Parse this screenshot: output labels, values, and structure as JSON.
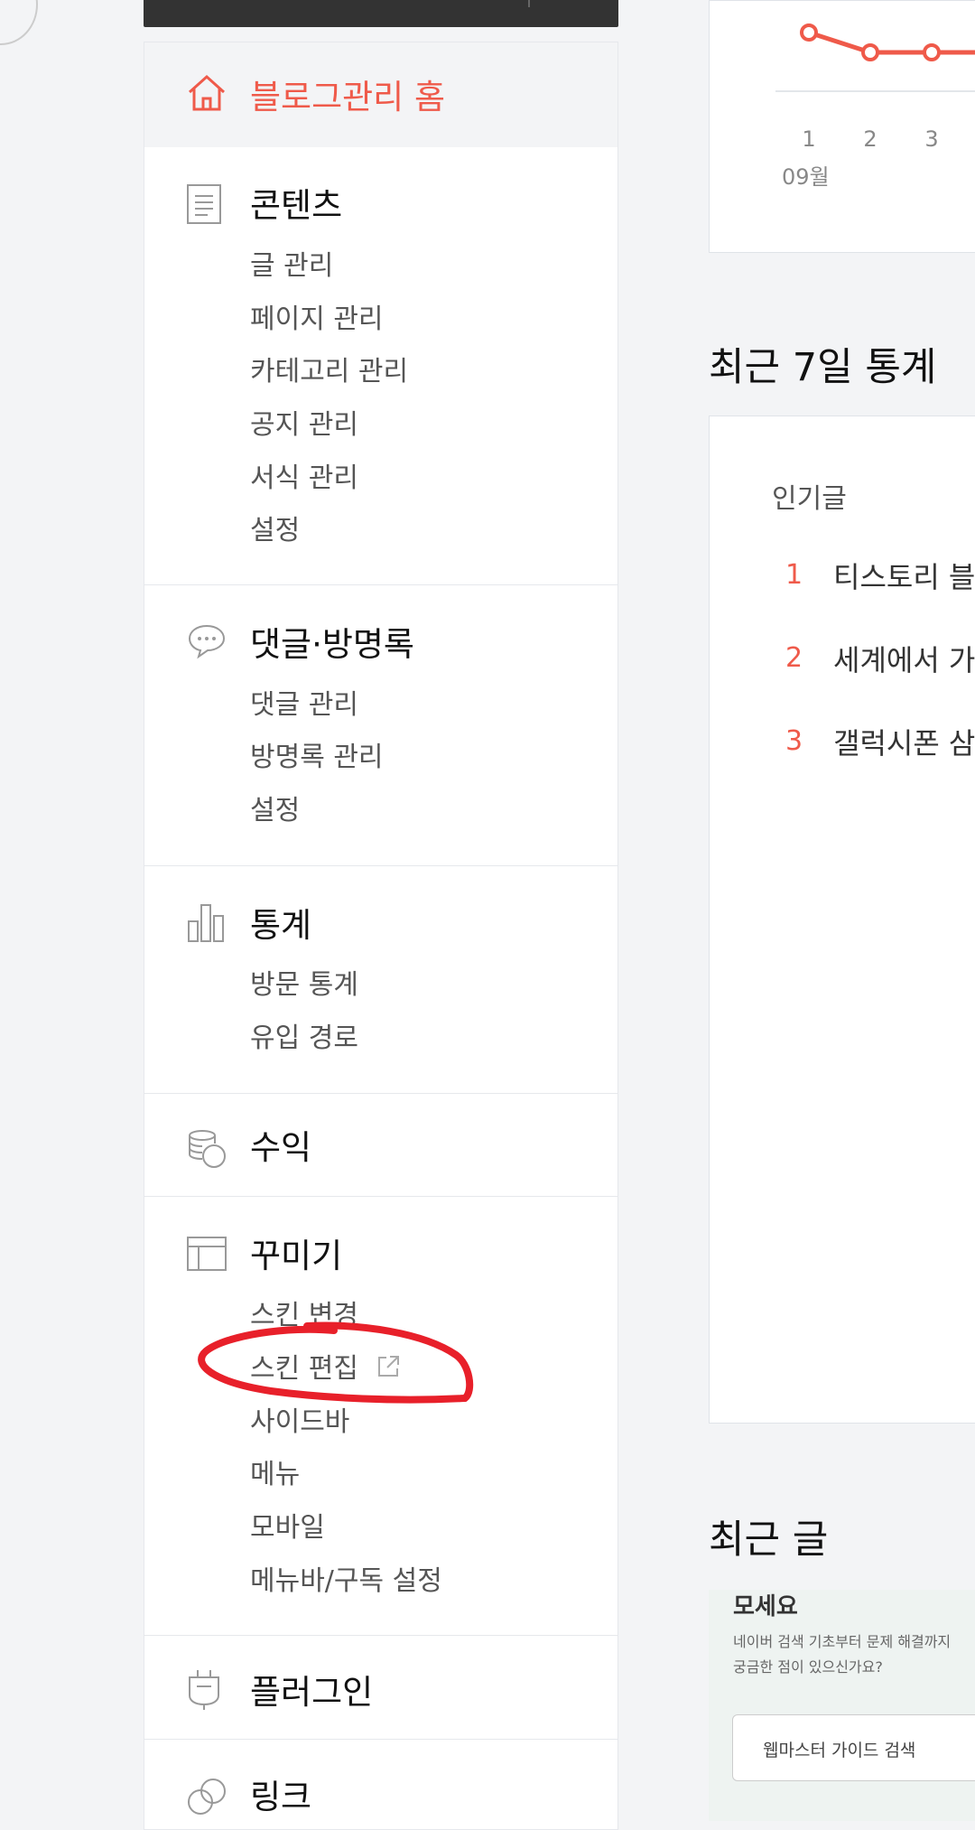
{
  "sidebar": {
    "home": {
      "label": "블로그관리 홈"
    },
    "sections": [
      {
        "title": "콘텐츠",
        "icon": "document-icon",
        "items": [
          "글 관리",
          "페이지 관리",
          "카테고리 관리",
          "공지 관리",
          "서식 관리",
          "설정"
        ]
      },
      {
        "title": "댓글·방명록",
        "icon": "comment-icon",
        "items": [
          "댓글 관리",
          "방명록 관리",
          "설정"
        ]
      },
      {
        "title": "통계",
        "icon": "bar-chart-icon",
        "items": [
          "방문 통계",
          "유입 경로"
        ]
      },
      {
        "title": "수익",
        "icon": "coins-icon",
        "items": []
      },
      {
        "title": "꾸미기",
        "icon": "layout-icon",
        "items": [
          "스킨 변경",
          "스킨 편집",
          "사이드바",
          "메뉴",
          "모바일",
          "메뉴바/구독 설정"
        ]
      },
      {
        "title": "플러그인",
        "icon": "plug-icon",
        "items": []
      },
      {
        "title": "링크",
        "icon": "link-icon",
        "items": []
      }
    ]
  },
  "main": {
    "chart": {
      "x_labels": [
        "1",
        "2",
        "3"
      ],
      "month_label": "09월"
    },
    "stats7": {
      "heading": "최근 7일 통계",
      "popular_label": "인기글",
      "posts": [
        {
          "rank": "1",
          "title": "티스토리 블"
        },
        {
          "rank": "2",
          "title": "세계에서 가"
        },
        {
          "rank": "3",
          "title": "갤럭시폰 삼"
        }
      ]
    },
    "recent": {
      "heading": "최근 글",
      "thumb_brand": "모세요",
      "thumb_desc_1": "네이버 검색 기초부터 문제 해결까지",
      "thumb_desc_2": "궁금한 점이 있으신가요?",
      "thumb_search": "웹마스터 가이드 검색"
    }
  },
  "colors": {
    "accent": "#ef5a4a",
    "annotation": "#e8202a"
  },
  "chart_data": {
    "type": "line",
    "categories": [
      "1",
      "2",
      "3"
    ],
    "series": [
      {
        "values": [
          3,
          1,
          1
        ]
      }
    ],
    "xlabel": "09월"
  }
}
